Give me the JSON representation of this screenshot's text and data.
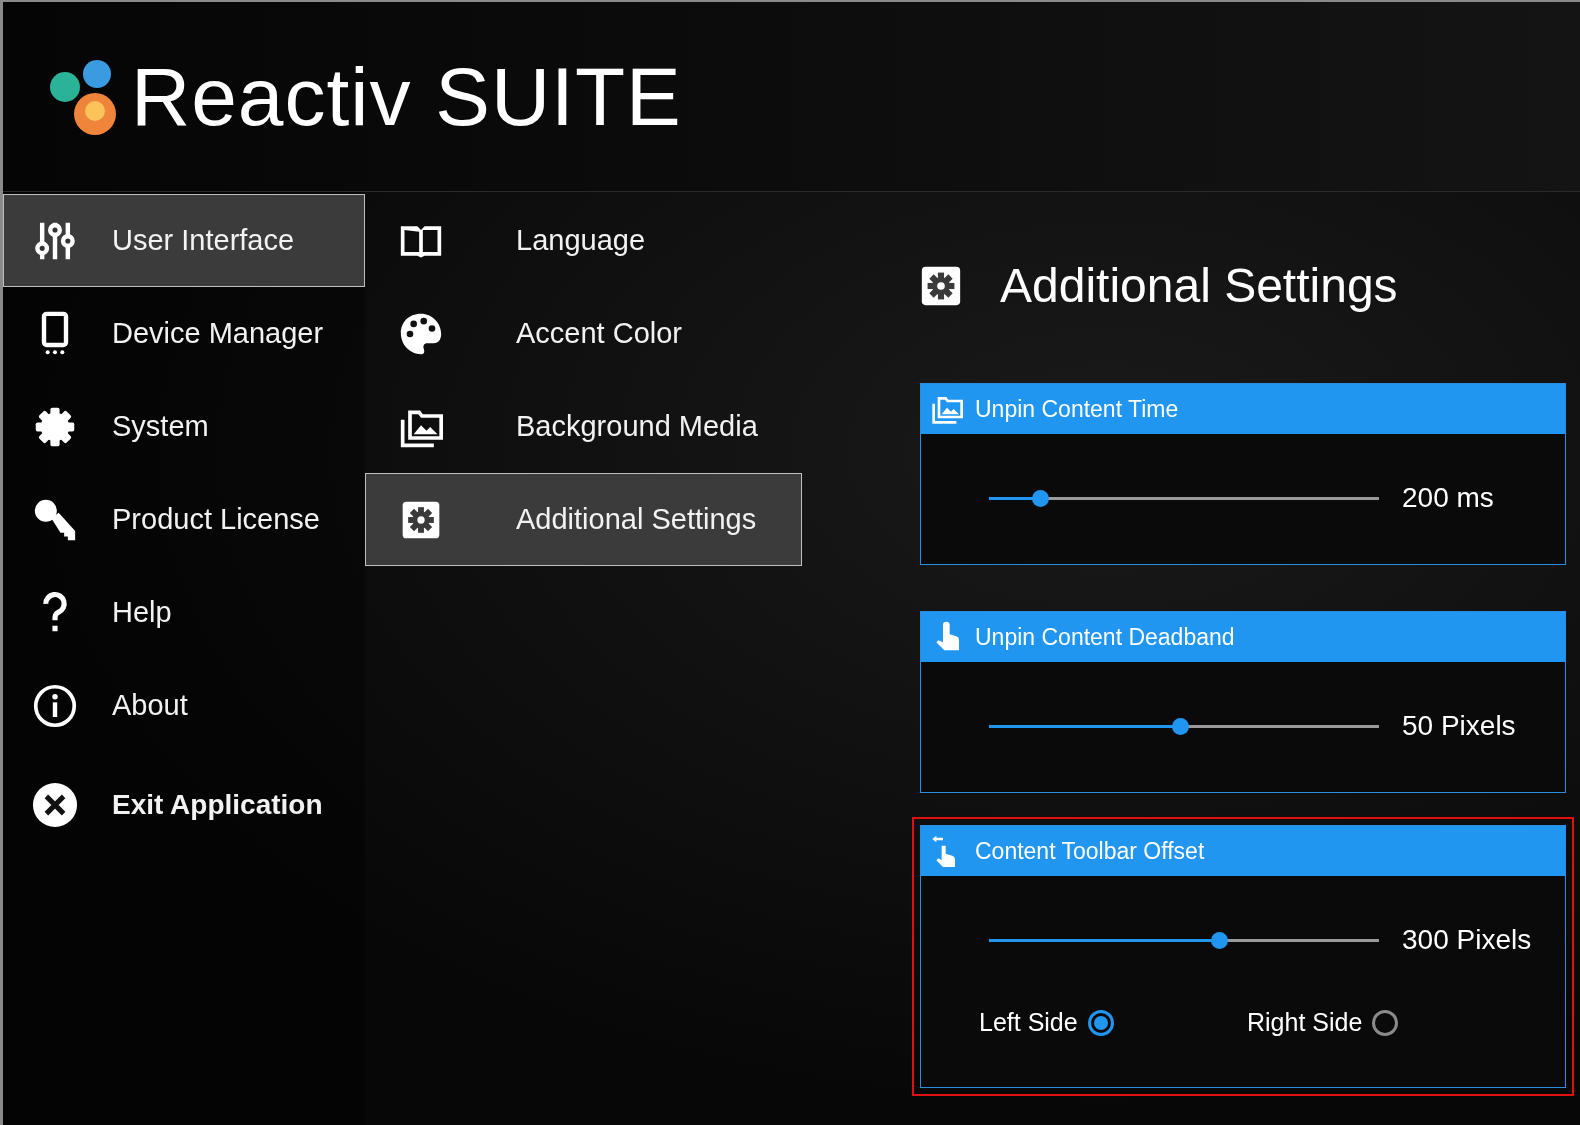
{
  "header": {
    "logo_text": "Reactiv SUITE"
  },
  "sidebar": {
    "items": [
      {
        "label": "User Interface",
        "kind": "page",
        "selected": true
      },
      {
        "label": "Device Manager",
        "kind": "page",
        "selected": false
      },
      {
        "label": "System",
        "kind": "page",
        "selected": false
      },
      {
        "label": "Product License",
        "kind": "page",
        "selected": false
      },
      {
        "label": "Help",
        "kind": "page",
        "selected": false
      },
      {
        "label": "About",
        "kind": "page",
        "selected": false
      },
      {
        "label": "Exit Application",
        "kind": "action",
        "selected": false
      }
    ]
  },
  "submenu": {
    "items": [
      {
        "label": "Language",
        "selected": false
      },
      {
        "label": "Accent Color",
        "selected": false
      },
      {
        "label": "Background Media",
        "selected": false
      },
      {
        "label": "Additional Settings",
        "selected": true
      }
    ]
  },
  "content": {
    "title": "Additional Settings",
    "panels": [
      {
        "title": "Unpin Content Time",
        "level": 0.13,
        "reading": "200 ms",
        "highlighted": false
      },
      {
        "title": "Unpin Content Deadband",
        "level": 0.49,
        "reading": "50 Pixels",
        "highlighted": false
      },
      {
        "title": "Content Toolbar Offset",
        "level": 0.59,
        "reading": "300 Pixels",
        "highlighted": true,
        "options": [
          {
            "label": "Left Side",
            "selected": true
          },
          {
            "label": "Right Side",
            "selected": false
          }
        ]
      }
    ]
  }
}
